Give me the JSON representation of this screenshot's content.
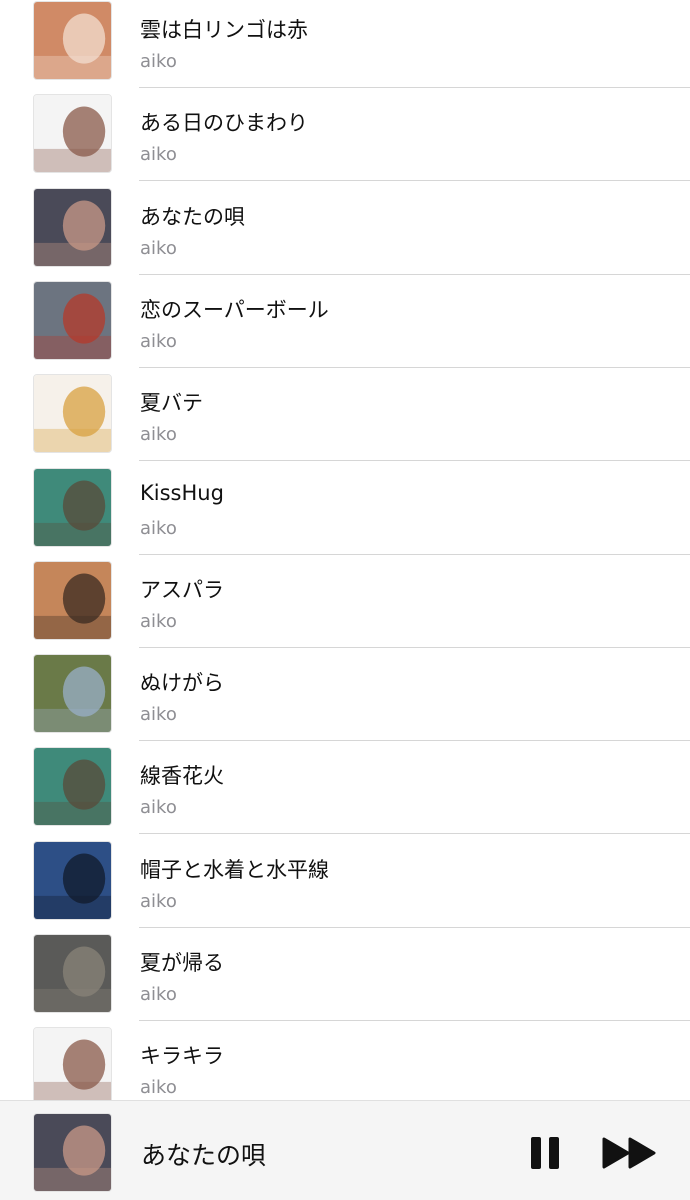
{
  "tracks": [
    {
      "title": "雲は白リンゴは赤",
      "artist": "aiko",
      "art_colors": [
        "#d08a66",
        "#f3ddd0"
      ]
    },
    {
      "title": "ある日のひまわり",
      "artist": "aiko",
      "art_colors": [
        "#f4f4f4",
        "#8a5a4a"
      ]
    },
    {
      "title": "あなたの唄",
      "artist": "aiko",
      "art_colors": [
        "#4a4a58",
        "#c99a88"
      ]
    },
    {
      "title": "恋のスーパーボール",
      "artist": "aiko",
      "art_colors": [
        "#6c7480",
        "#b53a2a"
      ]
    },
    {
      "title": "夏バテ",
      "artist": "aiko",
      "art_colors": [
        "#f6f1ea",
        "#d8a040"
      ]
    },
    {
      "title": "KissHug",
      "artist": "aiko",
      "art_colors": [
        "#3f8a7a",
        "#5a4a3a"
      ]
    },
    {
      "title": "アスパラ",
      "artist": "aiko",
      "art_colors": [
        "#c5865a",
        "#3a2a22"
      ]
    },
    {
      "title": "ぬけがら",
      "artist": "aiko",
      "art_colors": [
        "#6a7a48",
        "#9ab0c8"
      ]
    },
    {
      "title": "線香花火",
      "artist": "aiko",
      "art_colors": [
        "#3f8a7a",
        "#5a4a3a"
      ]
    },
    {
      "title": "帽子と水着と水平線",
      "artist": "aiko",
      "art_colors": [
        "#2d4f86",
        "#101a2a"
      ]
    },
    {
      "title": "夏が帰る",
      "artist": "aiko",
      "art_colors": [
        "#5a5a58",
        "#8a8478"
      ]
    },
    {
      "title": "キラキラ",
      "artist": "aiko",
      "art_colors": [
        "#f4f4f4",
        "#8a5a4a"
      ]
    }
  ],
  "now_playing": {
    "title": "あなたの唄",
    "art_colors": [
      "#4a4a58",
      "#c99a88"
    ],
    "pause_icon": "pause-icon",
    "next_icon": "forward-icon"
  }
}
